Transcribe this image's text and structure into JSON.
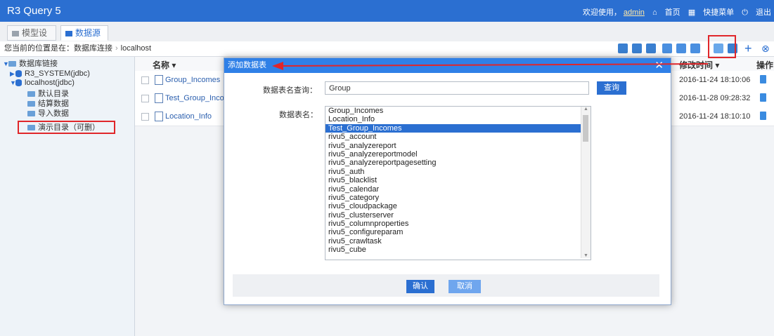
{
  "app_title": "R3 Query 5",
  "topbar": {
    "welcome": "欢迎使用，",
    "user": "admin",
    "home": "首页",
    "shortcut": "快捷菜单",
    "logout": "退出"
  },
  "tabs": [
    {
      "label": "模型设计"
    },
    {
      "label": "数据源"
    }
  ],
  "breadcrumb": {
    "prefix": "您当前的位置是在：数据库连接",
    "current": "localhost"
  },
  "tree": {
    "root": "数据库链接",
    "r3_system": "R3_SYSTEM(jdbc)",
    "localhost": "localhost(jdbc)",
    "children": [
      "默认目录",
      "结算数据",
      "导入数据",
      "演示目录（可删）"
    ]
  },
  "grid": {
    "col_name": "名称 ▾",
    "col_time": "修改时间 ▾",
    "col_ops": "操作",
    "rows": [
      {
        "name": "Group_Incomes",
        "time": "2016-11-24 18:10:06"
      },
      {
        "name": "Test_Group_Incom",
        "time": "2016-11-28 09:28:32"
      },
      {
        "name": "Location_Info",
        "time": "2016-11-24 18:10:10"
      }
    ]
  },
  "dialog": {
    "title": "添加数据表",
    "query_label": "数据表名查询：",
    "query_value": "Group",
    "query_button": "查询",
    "list_label": "数据表名：",
    "options": [
      "Group_Incomes",
      "Location_Info",
      "Test_Group_Incomes",
      "rivu5_account",
      "rivu5_analyzereport",
      "rivu5_analyzereportmodel",
      "rivu5_analyzereportpagesetting",
      "rivu5_auth",
      "rivu5_blacklist",
      "rivu5_calendar",
      "rivu5_category",
      "rivu5_cloudpackage",
      "rivu5_clusterserver",
      "rivu5_columnproperties",
      "rivu5_configureparam",
      "rivu5_crawltask",
      "rivu5_cube"
    ],
    "selected_index": 2,
    "confirm": "确认",
    "cancel": "取消"
  },
  "colors": {
    "primary": "#2b6fd1",
    "highlight": "#e0262a"
  }
}
